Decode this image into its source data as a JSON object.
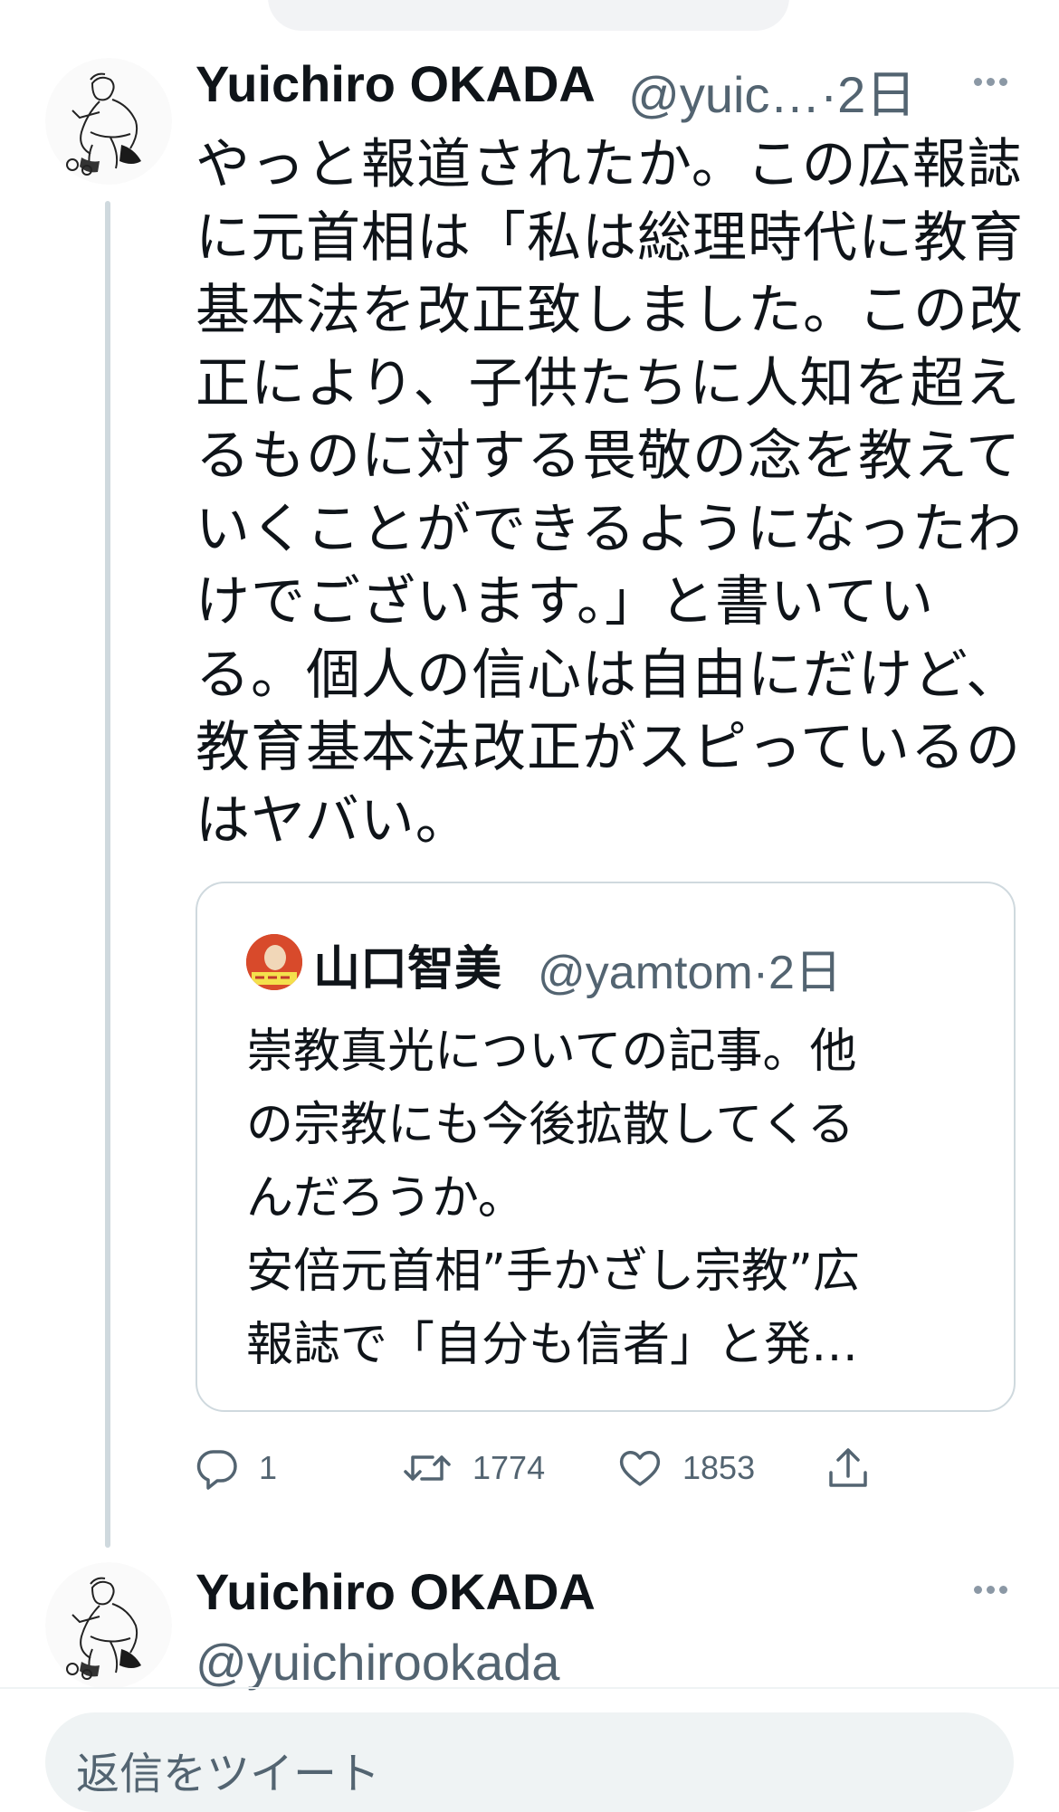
{
  "tweet1": {
    "author_name": "Yuichiro OKADA",
    "handle_time": "@yuic…·2日",
    "more_icon": "more-horizontal-icon",
    "body_lines": [
      "やっと報道されたか。この広報誌",
      "に元首相は「私は総理時代に教育",
      "基本法を改正致しました。この改",
      "正により、子供たちに人知を超え",
      "るものに対する畏敬の念を教えて",
      "いくことができるようになったわ",
      "けでございます。」と書いてい",
      "る。個人の信心は自由にだけど、",
      "教育基本法改正がスピっているの",
      "はヤバい。"
    ],
    "quote": {
      "author_name": "山口智美",
      "handle_time": "@yamtom·2日",
      "lines": [
        "崇教真光についての記事。他",
        "の宗教にも今後拡散してくる",
        "んだろうか。",
        "安倍元首相”手かざし宗教”広",
        "報誌で「自分も信者」と発…"
      ]
    },
    "actions": {
      "reply_count": "1",
      "retweet_count": "1774",
      "like_count": "1853",
      "reply_icon": "reply-icon",
      "retweet_icon": "retweet-icon",
      "like_icon": "heart-icon",
      "share_icon": "share-icon"
    }
  },
  "tweet2": {
    "author_name": "Yuichiro OKADA",
    "handle": "@yuichirookada"
  },
  "reply_bar": {
    "placeholder": "返信をツイート"
  },
  "colors": {
    "text": "#0f1419",
    "secondary": "#536471",
    "border": "#cfd9de"
  }
}
